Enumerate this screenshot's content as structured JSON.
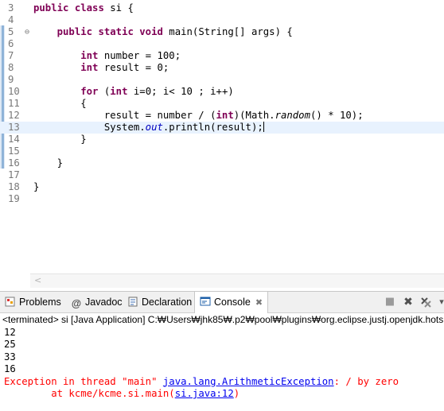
{
  "editor": {
    "lines": [
      {
        "num": "3",
        "parts": [
          {
            "t": "public",
            "c": "kw"
          },
          {
            "t": " "
          },
          {
            "t": "class",
            "c": "kw"
          },
          {
            "t": " si {"
          }
        ]
      },
      {
        "num": "4",
        "parts": []
      },
      {
        "num": "5",
        "fold": "⊖",
        "parts": [
          {
            "t": "    "
          },
          {
            "t": "public",
            "c": "kw"
          },
          {
            "t": " "
          },
          {
            "t": "static",
            "c": "kw"
          },
          {
            "t": " "
          },
          {
            "t": "void",
            "c": "kw"
          },
          {
            "t": " main(String[] args) {"
          }
        ]
      },
      {
        "num": "6",
        "parts": []
      },
      {
        "num": "7",
        "parts": [
          {
            "t": "        "
          },
          {
            "t": "int",
            "c": "kw"
          },
          {
            "t": " number = 100;"
          }
        ]
      },
      {
        "num": "8",
        "parts": [
          {
            "t": "        "
          },
          {
            "t": "int",
            "c": "kw"
          },
          {
            "t": " result = 0;"
          }
        ]
      },
      {
        "num": "9",
        "parts": []
      },
      {
        "num": "10",
        "parts": [
          {
            "t": "        "
          },
          {
            "t": "for",
            "c": "kw"
          },
          {
            "t": " ("
          },
          {
            "t": "int",
            "c": "kw"
          },
          {
            "t": " i=0; i< 10 ; i++)"
          }
        ]
      },
      {
        "num": "11",
        "parts": [
          {
            "t": "        {"
          }
        ]
      },
      {
        "num": "12",
        "parts": [
          {
            "t": "            result = number / ("
          },
          {
            "t": "int",
            "c": "kw"
          },
          {
            "t": ")(Math."
          },
          {
            "t": "random",
            "c": "mth"
          },
          {
            "t": "() * 10);"
          }
        ]
      },
      {
        "num": "13",
        "current": true,
        "parts": [
          {
            "t": "            System."
          },
          {
            "t": "out",
            "c": "fld"
          },
          {
            "t": ".println(result);"
          }
        ]
      },
      {
        "num": "14",
        "parts": [
          {
            "t": "        }"
          }
        ]
      },
      {
        "num": "15",
        "parts": []
      },
      {
        "num": "16",
        "parts": [
          {
            "t": "    }"
          }
        ]
      },
      {
        "num": "17",
        "parts": []
      },
      {
        "num": "18",
        "parts": [
          {
            "t": "}"
          }
        ]
      },
      {
        "num": "19",
        "parts": []
      }
    ]
  },
  "panel": {
    "tabs": [
      {
        "id": "problems",
        "label": "Problems",
        "icon": "problems-icon"
      },
      {
        "id": "javadoc",
        "label": "Javadoc",
        "icon": "at-icon"
      },
      {
        "id": "declaration",
        "label": "Declaration",
        "icon": "declaration-icon"
      },
      {
        "id": "console",
        "label": "Console",
        "icon": "console-icon",
        "active": true
      }
    ],
    "tab_close_glyph": "✖",
    "status": "<terminated> si [Java Application] C:₩Users₩jhk85₩.p2₩pool₩plugins₩org.eclipse.justj.openjdk.hotspot",
    "output": [
      "12",
      "25",
      "33",
      "16"
    ],
    "exception": {
      "prefix": "Exception in thread \"main\" ",
      "type": "java.lang.ArithmeticException",
      "message": ": / by zero",
      "at_prefix": "        at kcme/kcme.si.main(",
      "location": "si.java:12",
      "at_suffix": ")"
    }
  },
  "colors": {
    "keyword": "#7f0055",
    "field": "#0000c0",
    "error": "#ff0000",
    "link": "#0000ee",
    "current_line": "#e8f2fe"
  }
}
